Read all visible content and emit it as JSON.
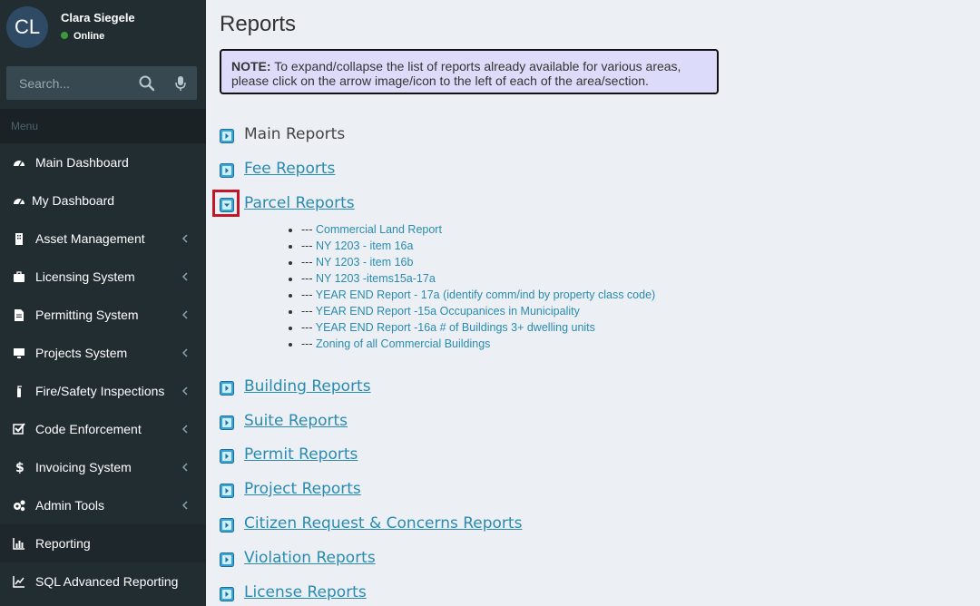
{
  "user": {
    "initials": "CL",
    "name": "Clara Siegele",
    "status": "Online",
    "status_color": "#3c9a3c"
  },
  "search": {
    "placeholder": "Search..."
  },
  "menu_header": "Menu",
  "menu": [
    {
      "label": "Main Dashboard",
      "icon": "dashboard-icon",
      "has_children": false
    },
    {
      "label": "My Dashboard",
      "icon": "dashboard-icon",
      "has_children": false
    },
    {
      "label": "Asset Management",
      "icon": "building-icon",
      "has_children": true
    },
    {
      "label": "Licensing System",
      "icon": "briefcase-icon",
      "has_children": true
    },
    {
      "label": "Permitting System",
      "icon": "document-icon",
      "has_children": true
    },
    {
      "label": "Projects System",
      "icon": "monitor-icon",
      "has_children": true
    },
    {
      "label": "Fire/Safety Inspections",
      "icon": "fire-extinguisher-icon",
      "has_children": true
    },
    {
      "label": "Code Enforcement",
      "icon": "checkbox-icon",
      "has_children": true
    },
    {
      "label": "Invoicing System",
      "icon": "dollar-icon",
      "has_children": true
    },
    {
      "label": "Admin Tools",
      "icon": "cogs-icon",
      "has_children": true
    },
    {
      "label": "Reporting",
      "icon": "bar-chart-icon",
      "has_children": false,
      "active": true
    },
    {
      "label": "SQL Advanced Reporting",
      "icon": "line-chart-icon",
      "has_children": false
    }
  ],
  "page": {
    "title": "Reports",
    "note_label": "NOTE:",
    "note_text": "To expand/collapse the list of reports already available for various areas, please click on the arrow image/icon to the left of each of the area/section."
  },
  "sections": [
    {
      "label": "Main Reports",
      "linked": false
    },
    {
      "label": "Fee Reports",
      "linked": true
    },
    {
      "label": "Parcel Reports",
      "linked": true,
      "expanded": true
    },
    {
      "label": "Building Reports",
      "linked": true
    },
    {
      "label": "Suite Reports",
      "linked": true
    },
    {
      "label": "Permit Reports",
      "linked": true
    },
    {
      "label": "Project Reports",
      "linked": true
    },
    {
      "label": "Citizen Request & Concerns Reports",
      "linked": true
    },
    {
      "label": "Violation Reports",
      "linked": true
    },
    {
      "label": "License Reports",
      "linked": true
    }
  ],
  "parcel_reports": {
    "prefix": "---",
    "items": [
      "Commercial Land Report",
      "NY 1203 - item 16a",
      "NY 1203 - item 16b",
      "NY 1203 -items15a-17a",
      "YEAR END Report - 17a (identify comm/ind by property class code)",
      "YEAR END Report -15a Occupanices in Municipality",
      "YEAR END Report -16a # of Buildings 3+ dwelling units",
      "Zoning of all Commercial Buildings"
    ]
  },
  "colors": {
    "sidebar_bg": "#222d32",
    "link": "#2a8bb0",
    "highlight": "#c0182a",
    "note_bg": "#dcdcfa"
  }
}
